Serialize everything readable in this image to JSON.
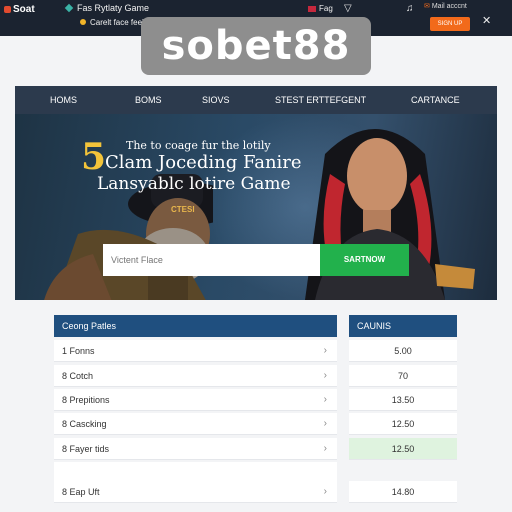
{
  "topbar": {
    "logo": "Soat",
    "promo_line1": "Fas Rytlaty Game",
    "promo_line2": "Carelt face feel fis",
    "flag_label": "Fag",
    "email_label": "Mail acccnt",
    "signup_label": "SIGN UP"
  },
  "brand": {
    "text": "sobet88"
  },
  "nav": {
    "items": [
      {
        "label": "HOMS"
      },
      {
        "label": "BOMS"
      },
      {
        "label": "SIOVS"
      },
      {
        "label": "STEST ERTTEFGENT"
      },
      {
        "label": "CARTANCE"
      }
    ]
  },
  "hero": {
    "number": "5",
    "subtitle": "The to coage fur the lotily",
    "title_line1": "Clam Joceding Fanire",
    "title_line2": "Lansyablc lotire Game",
    "small_text": "CTESI",
    "input_placeholder": "Victent Flace",
    "button_label": "SARTNOW"
  },
  "left_table": {
    "header": "Ceong Patles",
    "rows": [
      {
        "label": "1  Fonns"
      },
      {
        "label": "8  Cotch"
      },
      {
        "label": "8  Prepitions"
      },
      {
        "label": "8  Cascking"
      },
      {
        "label": "8  Fayer tids"
      },
      {
        "label": ""
      },
      {
        "label": "8  Eap Uft"
      }
    ]
  },
  "right_table": {
    "header": "CAUNIS",
    "rows": [
      {
        "value": "5.00",
        "highlight": false
      },
      {
        "value": "70",
        "highlight": false
      },
      {
        "value": "13.50",
        "highlight": false
      },
      {
        "value": "12.50",
        "highlight": false
      },
      {
        "value": "12.50",
        "highlight": true
      },
      {
        "value": "",
        "highlight": false
      },
      {
        "value": "14.80",
        "highlight": false
      }
    ]
  },
  "colors": {
    "topbar": "#1b2330",
    "nav": "#2c3a4d",
    "table_header": "#1f4f7f",
    "cta": "#22b14c",
    "signup": "#f26a1b"
  }
}
